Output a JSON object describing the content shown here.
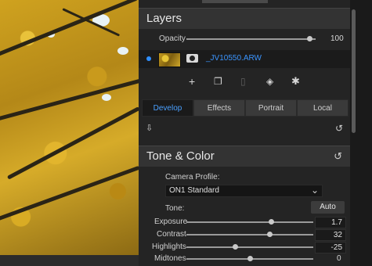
{
  "layers": {
    "title": "Layers",
    "opacity_label": "Opacity",
    "opacity_value": "100",
    "opacity_level": 0.95,
    "layer_name": "_JV10550.ARW",
    "toolbar_icons": [
      "add-layer-icon",
      "duplicate-layer-icon",
      "delete-layer-icon",
      "stack-icon",
      "settings-icon"
    ]
  },
  "tabs": [
    {
      "label": "Develop",
      "active": true
    },
    {
      "label": "Effects",
      "active": false
    },
    {
      "label": "Portrait",
      "active": false
    },
    {
      "label": "Local",
      "active": false
    }
  ],
  "tone_color": {
    "title": "Tone & Color",
    "camera_profile_label": "Camera Profile:",
    "camera_profile_value": "ON1 Standard",
    "tone_label": "Tone:",
    "auto_label": "Auto",
    "sliders": [
      {
        "label": "Exposure",
        "value": "1.7"
      },
      {
        "label": "Contrast",
        "value": "32"
      },
      {
        "label": "Highlights",
        "value": "-25"
      },
      {
        "label": "Midtones",
        "value": "0"
      }
    ]
  },
  "colors": {
    "accent": "#3b95ff",
    "panel_bg": "#242424",
    "section_header_bg": "#333333"
  }
}
